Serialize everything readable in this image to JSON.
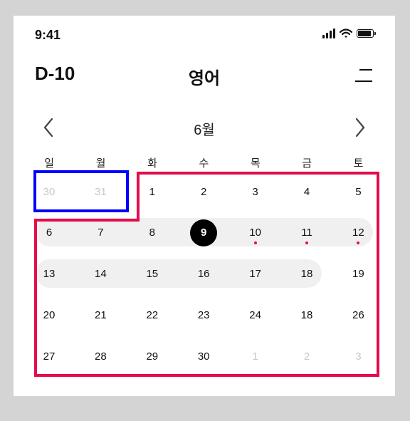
{
  "status": {
    "time": "9:41"
  },
  "header": {
    "dday": "D-10",
    "title": "영어"
  },
  "calendar": {
    "month": "6월",
    "weekdays": [
      "일",
      "월",
      "화",
      "수",
      "목",
      "금",
      "토"
    ],
    "weeks": [
      [
        {
          "d": "30",
          "muted": true
        },
        {
          "d": "31",
          "muted": true
        },
        {
          "d": "1"
        },
        {
          "d": "2"
        },
        {
          "d": "3"
        },
        {
          "d": "4"
        },
        {
          "d": "5"
        }
      ],
      [
        {
          "d": "6"
        },
        {
          "d": "7"
        },
        {
          "d": "8"
        },
        {
          "d": "9",
          "selected": true
        },
        {
          "d": "10",
          "dot": true
        },
        {
          "d": "11",
          "dot": true
        },
        {
          "d": "12",
          "dot": true
        }
      ],
      [
        {
          "d": "13"
        },
        {
          "d": "14"
        },
        {
          "d": "15"
        },
        {
          "d": "16"
        },
        {
          "d": "17"
        },
        {
          "d": "18"
        },
        {
          "d": "19"
        }
      ],
      [
        {
          "d": "20"
        },
        {
          "d": "21"
        },
        {
          "d": "22"
        },
        {
          "d": "23"
        },
        {
          "d": "24"
        },
        {
          "d": "18"
        },
        {
          "d": "26"
        }
      ],
      [
        {
          "d": "27"
        },
        {
          "d": "28"
        },
        {
          "d": "29"
        },
        {
          "d": "30"
        },
        {
          "d": "1",
          "muted": true
        },
        {
          "d": "2",
          "muted": true
        },
        {
          "d": "3",
          "muted": true
        }
      ]
    ]
  },
  "colors": {
    "dot": "#e60a4b",
    "outline_red": "#e60a4b",
    "outline_blue": "#0000ff",
    "selected": "#000000"
  }
}
